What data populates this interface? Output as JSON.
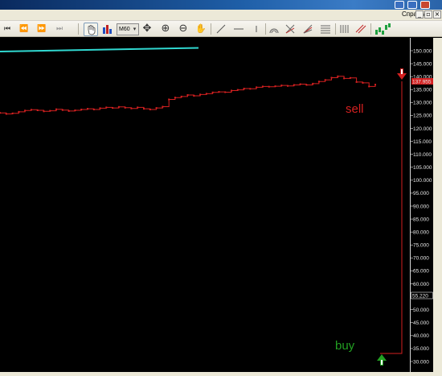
{
  "menu": {
    "help": "Справка"
  },
  "window_controls": {
    "minimize": "_",
    "restore": "▫",
    "close": "×"
  },
  "toolbar": {
    "timeframe": "M60"
  },
  "signals": {
    "sell_label": "sell",
    "buy_label": "buy"
  },
  "colors": {
    "price_line": "#d42020",
    "sell": "#d42020",
    "buy": "#22a022",
    "indicator_line": "#30d8d0",
    "grid": "#ffffff"
  },
  "chart_data": {
    "type": "line",
    "y_axis_labels": [
      "150.000",
      "145.000",
      "140.000",
      "135.000",
      "130.000",
      "125.000",
      "120.000",
      "115.000",
      "110.000",
      "105.000",
      "100.000",
      "95.000",
      "90.000",
      "85.000",
      "80.000",
      "75.000",
      "70.000",
      "65.000",
      "60.000",
      "55.000",
      "50.000",
      "45.000",
      "40.000",
      "35.000",
      "30.000"
    ],
    "ylim": [
      28000,
      152000
    ],
    "price_label": "137.955",
    "level_label": "55.220",
    "price_series": [
      126000,
      125600,
      125800,
      126400,
      126900,
      127200,
      127000,
      126600,
      126800,
      127400,
      127100,
      126700,
      127000,
      127300,
      127600,
      127300,
      127800,
      128100,
      127900,
      128300,
      128000,
      127700,
      128100,
      127600,
      127300,
      127900,
      128400,
      131200,
      131900,
      132300,
      132900,
      132600,
      133100,
      133400,
      133900,
      134100,
      134000,
      134600,
      134900,
      135400,
      135300,
      135900,
      136200,
      136100,
      136300,
      136600,
      136400,
      136800,
      137100,
      136800,
      137300,
      138100,
      138700,
      139600,
      140100,
      139300,
      139500,
      137900,
      137600,
      136200,
      136900
    ]
  }
}
